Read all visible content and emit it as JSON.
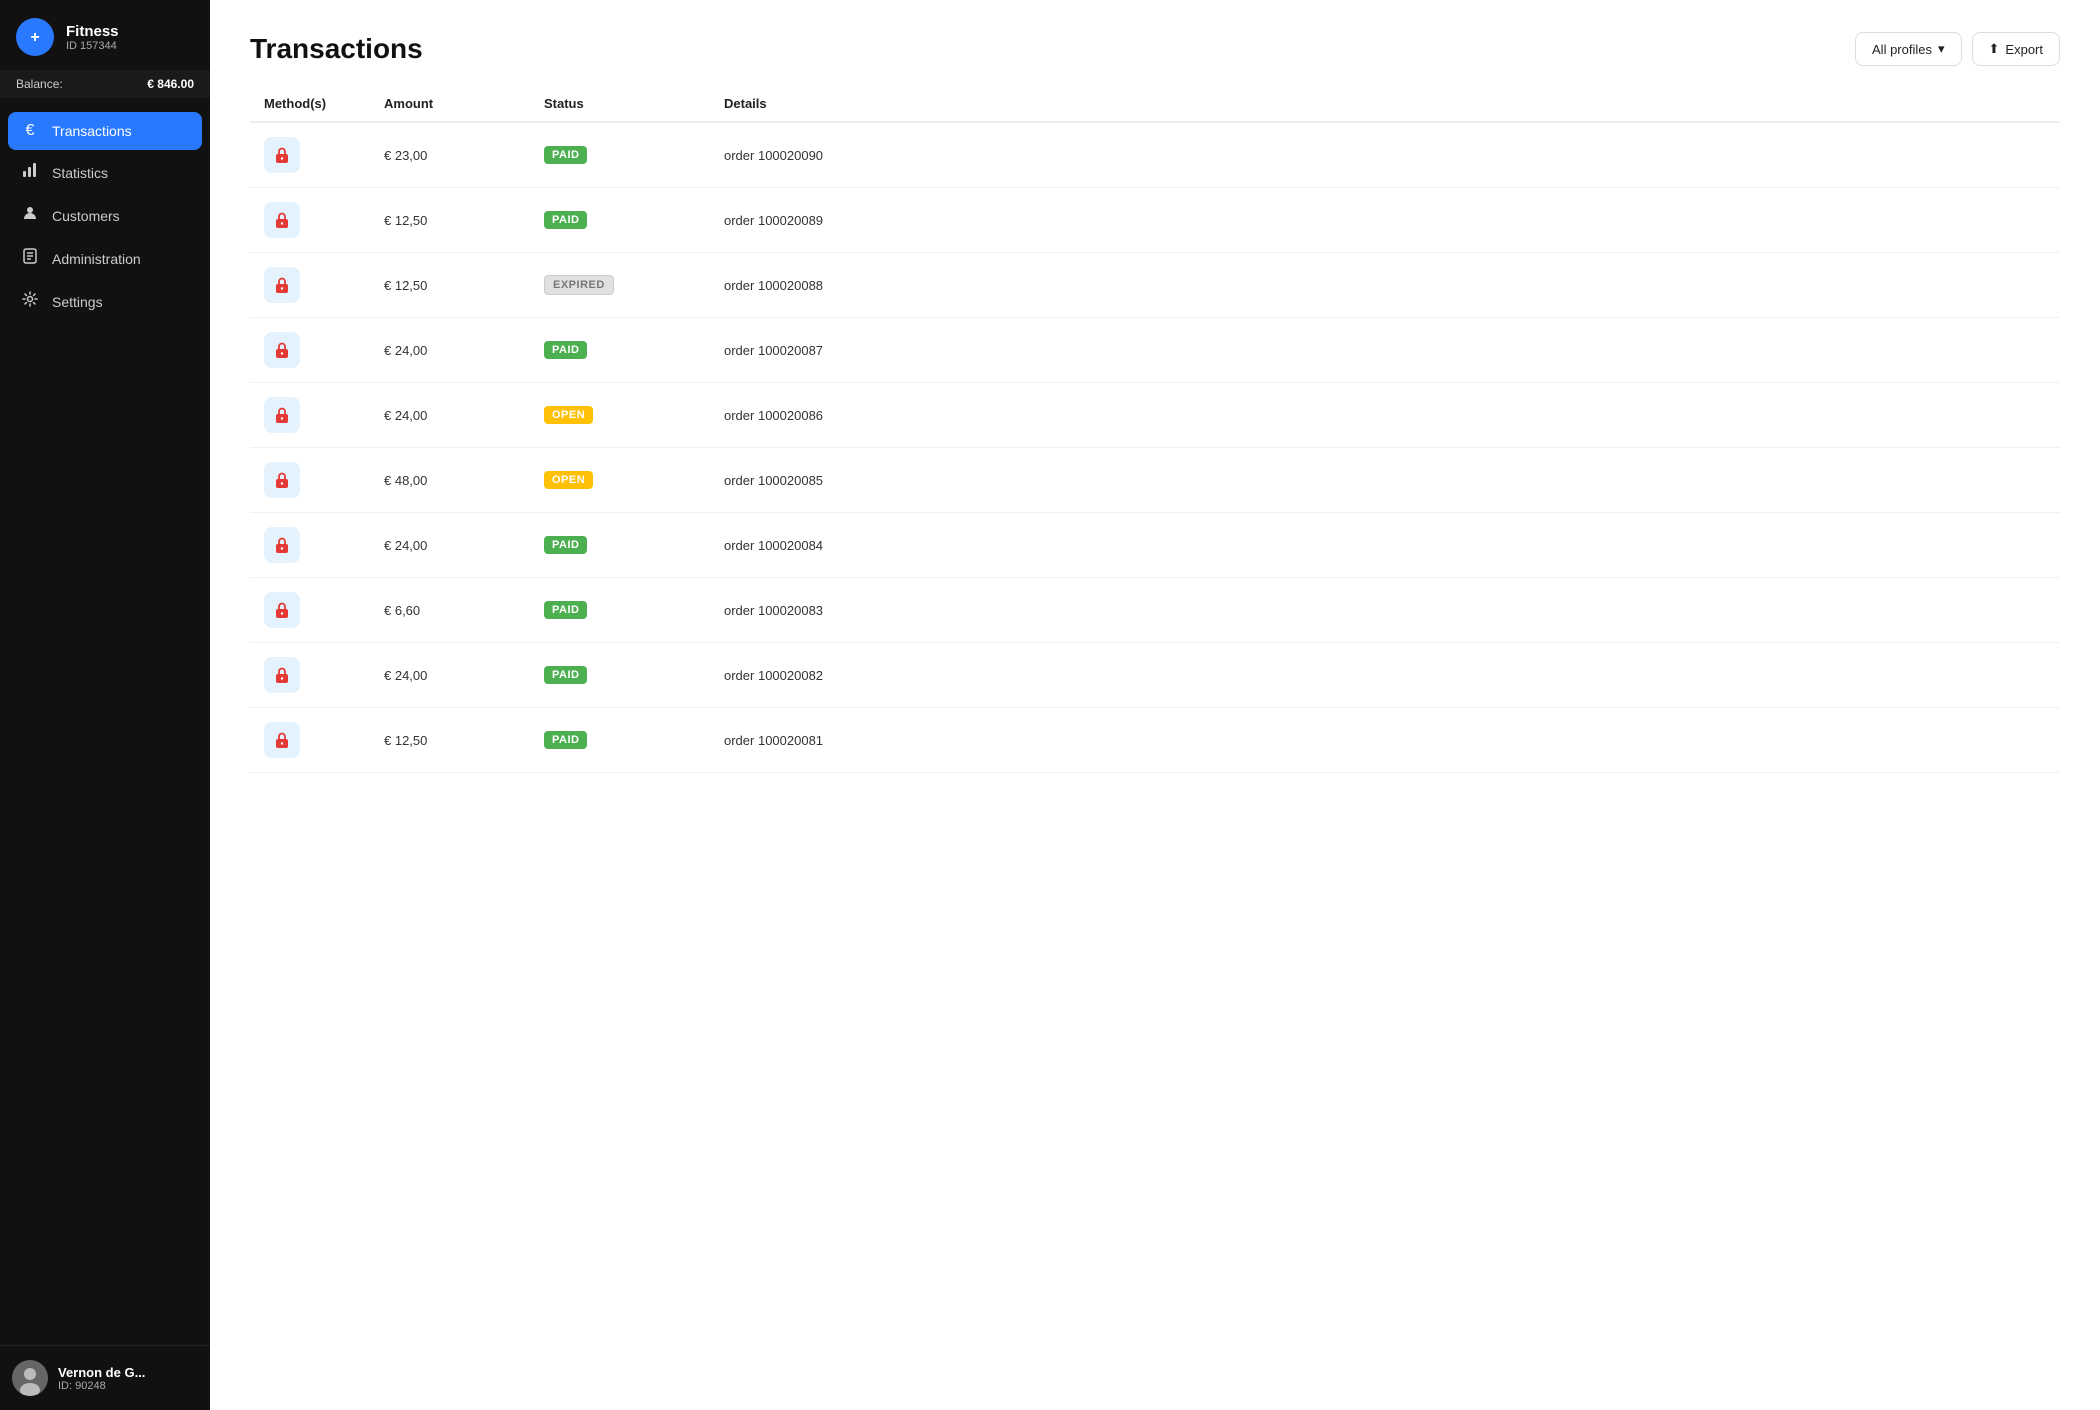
{
  "sidebar": {
    "brand": {
      "name": "Fitness",
      "id": "ID 157344",
      "logo_symbol": "+"
    },
    "balance_label": "Balance:",
    "balance_value": "€ 846.00",
    "nav_items": [
      {
        "id": "transactions",
        "label": "Transactions",
        "active": true,
        "icon": "euro"
      },
      {
        "id": "statistics",
        "label": "Statistics",
        "active": false,
        "icon": "chart"
      },
      {
        "id": "customers",
        "label": "Customers",
        "active": false,
        "icon": "person"
      },
      {
        "id": "administration",
        "label": "Administration",
        "active": false,
        "icon": "doc"
      },
      {
        "id": "settings",
        "label": "Settings",
        "active": false,
        "icon": "gear"
      }
    ],
    "user": {
      "name": "Vernon de G...",
      "id": "ID: 90248"
    }
  },
  "header": {
    "title": "Transactions",
    "profiles_btn": "All profiles",
    "export_btn": "Export"
  },
  "table": {
    "columns": [
      "Method(s)",
      "Amount",
      "Status",
      "Details"
    ],
    "rows": [
      {
        "amount": "€ 23,00",
        "status": "PAID",
        "status_type": "paid",
        "details": "order 100020090"
      },
      {
        "amount": "€ 12,50",
        "status": "PAID",
        "status_type": "paid",
        "details": "order 100020089"
      },
      {
        "amount": "€ 12,50",
        "status": "EXPIRED",
        "status_type": "expired",
        "details": "order 100020088"
      },
      {
        "amount": "€ 24,00",
        "status": "PAID",
        "status_type": "paid",
        "details": "order 100020087"
      },
      {
        "amount": "€ 24,00",
        "status": "OPEN",
        "status_type": "open",
        "details": "order 100020086"
      },
      {
        "amount": "€ 48,00",
        "status": "OPEN",
        "status_type": "open",
        "details": "order 100020085"
      },
      {
        "amount": "€ 24,00",
        "status": "PAID",
        "status_type": "paid",
        "details": "order 100020084"
      },
      {
        "amount": "€ 6,60",
        "status": "PAID",
        "status_type": "paid",
        "details": "order 100020083"
      },
      {
        "amount": "€ 24,00",
        "status": "PAID",
        "status_type": "paid",
        "details": "order 100020082"
      },
      {
        "amount": "€ 12,50",
        "status": "PAID",
        "status_type": "paid",
        "details": "order 100020081"
      }
    ]
  }
}
